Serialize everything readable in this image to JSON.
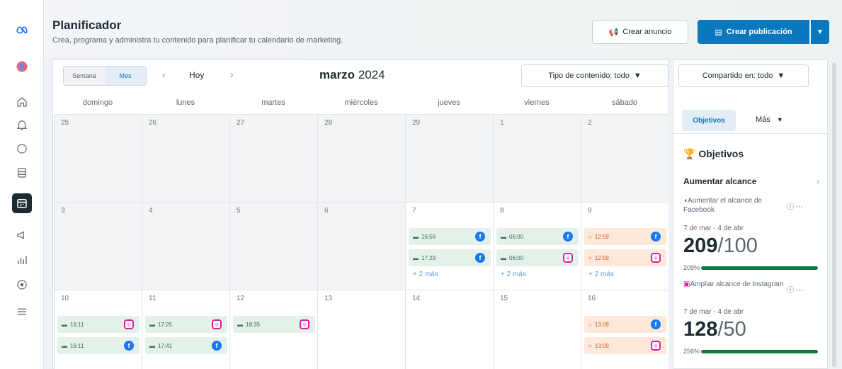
{
  "header": {
    "title": "Planificador",
    "subtitle": "Crea, programa y administra tu contenido para planificar tu calendario de marketing.",
    "create_ad": "Crear anuncio",
    "create_post": "Crear publicación"
  },
  "toolbar": {
    "view_week": "Semana",
    "view_month": "Mes",
    "today": "Hoy",
    "month_name": "marzo",
    "year": "2024",
    "content_filter": "Tipo de contenido: todo"
  },
  "days": [
    "domingo",
    "lunes",
    "martes",
    "miércoles",
    "jueves",
    "viernes",
    "sábado"
  ],
  "weeks": [
    {
      "dates": [
        "25",
        "26",
        "27",
        "28",
        "29",
        "1",
        "2"
      ],
      "past": [
        true,
        true,
        true,
        true,
        true,
        true,
        true
      ]
    },
    {
      "dates": [
        "3",
        "4",
        "5",
        "6",
        "7",
        "8",
        "9"
      ],
      "past": [
        true,
        true,
        true,
        true,
        false,
        false,
        false
      ]
    },
    {
      "dates": [
        "10",
        "11",
        "12",
        "13",
        "14",
        "15",
        "16"
      ],
      "past": [
        false,
        false,
        false,
        false,
        false,
        false,
        false
      ]
    }
  ],
  "events": [
    {
      "week": 1,
      "day": 4,
      "slot": 0,
      "time": "16:56",
      "net": "fb",
      "kind": "green"
    },
    {
      "week": 1,
      "day": 4,
      "slot": 1,
      "time": "17:29",
      "net": "fb",
      "kind": "green"
    },
    {
      "week": 1,
      "day": 5,
      "slot": 0,
      "time": "06:00",
      "net": "fb",
      "kind": "green"
    },
    {
      "week": 1,
      "day": 5,
      "slot": 1,
      "time": "06:00",
      "net": "ig",
      "kind": "green"
    },
    {
      "week": 1,
      "day": 6,
      "slot": 0,
      "time": "12:59",
      "net": "fb",
      "kind": "orange"
    },
    {
      "week": 1,
      "day": 6,
      "slot": 1,
      "time": "12:59",
      "net": "ig",
      "kind": "orange"
    },
    {
      "week": 2,
      "day": 0,
      "slot": 0,
      "time": "16:11",
      "net": "ig",
      "kind": "green"
    },
    {
      "week": 2,
      "day": 0,
      "slot": 1,
      "time": "16:11",
      "net": "fb",
      "kind": "green"
    },
    {
      "week": 2,
      "day": 1,
      "slot": 0,
      "time": "17:25",
      "net": "ig",
      "kind": "green"
    },
    {
      "week": 2,
      "day": 1,
      "slot": 1,
      "time": "17:41",
      "net": "fb",
      "kind": "green"
    },
    {
      "week": 2,
      "day": 2,
      "slot": 0,
      "time": "18:35",
      "net": "ig",
      "kind": "green"
    },
    {
      "week": 2,
      "day": 6,
      "slot": 0,
      "time": "13:09",
      "net": "fb",
      "kind": "orange"
    },
    {
      "week": 2,
      "day": 6,
      "slot": 1,
      "time": "13:09",
      "net": "ig",
      "kind": "orange"
    }
  ],
  "more_links": [
    {
      "week": 1,
      "day": 4,
      "text": "+ 2 más"
    },
    {
      "week": 1,
      "day": 5,
      "text": "+ 2 más"
    },
    {
      "week": 1,
      "day": 6,
      "text": "+ 2 más"
    }
  ],
  "panel": {
    "share_filter": "Compartido en: todo",
    "tab_objectives": "Objetivos",
    "tab_more": "Más",
    "title": "Objetivos",
    "goal_group": "Aumentar alcance",
    "goals": [
      {
        "name": "Aumentar el alcance de Facebook",
        "dates": "7 de mar - 4 de abr",
        "value": "209",
        "target": "/100",
        "pct_label": "209%",
        "fill": 1.0,
        "net": "fb"
      },
      {
        "name": "Ampliar alcance de Instagram",
        "dates": "7 de mar - 4 de abr",
        "value": "128",
        "target": "/50",
        "pct_label": "256%",
        "fill": 1.0,
        "net": "ig"
      }
    ]
  },
  "colors": {
    "primary": "#0a78be",
    "green_bar": "#0c7a3f",
    "fb": "#1877f2",
    "ig": "#d6249f",
    "event_green": "#e3f1e8",
    "event_orange": "#fde8d9"
  }
}
